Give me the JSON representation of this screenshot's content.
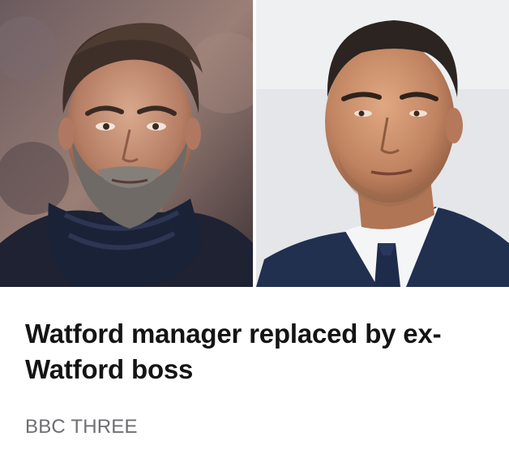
{
  "article": {
    "headline": "Watford manager replaced by ex-Watford boss",
    "source": "BBC THREE"
  },
  "images": {
    "left_photo": "man-with-beard-and-scarf-photo",
    "right_photo": "man-in-suit-and-tie-photo"
  },
  "colors": {
    "headline": "#141414",
    "source": "#6e6e73",
    "background": "#ffffff"
  }
}
